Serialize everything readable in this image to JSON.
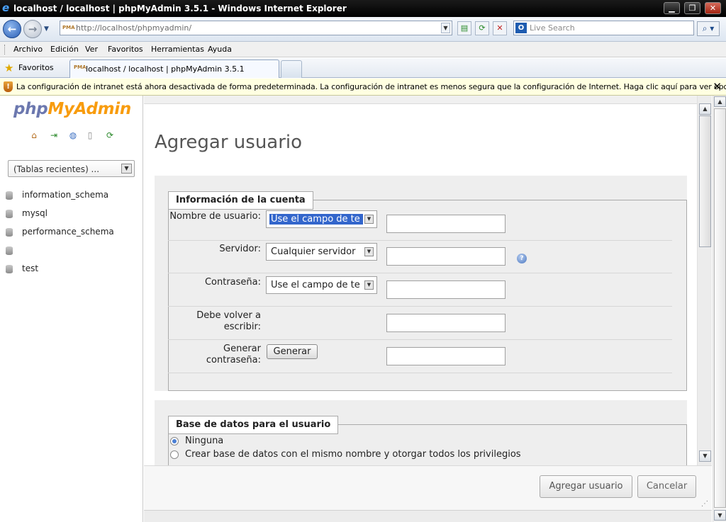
{
  "window": {
    "title": "localhost / localhost | phpMyAdmin 3.5.1 - Windows Internet Explorer",
    "minimize": "▁",
    "maximize": "❐",
    "close": "✕"
  },
  "address": {
    "url": "http://localhost/phpmyadmin/",
    "search_placeholder": "Live Search"
  },
  "menu": [
    "Archivo",
    "Edición",
    "Ver",
    "Favoritos",
    "Herramientas",
    "Ayuda"
  ],
  "favorites": {
    "label": "Favoritos",
    "tab_title": "localhost / localhost | phpMyAdmin 3.5.1"
  },
  "infobar": {
    "text": "La configuración de intranet está ahora desactivada de forma predeterminada. La configuración de intranet es menos segura que la configuración de Internet. Haga clic aquí para ver  opciones..."
  },
  "sidebar": {
    "logo_php": "php",
    "logo_myadmin": "MyAdmin",
    "recent_tables": "(Tablas recientes) ...",
    "databases": [
      "information_schema",
      "mysql",
      "performance_schema",
      "",
      "test"
    ]
  },
  "page": {
    "title": "Agregar usuario",
    "account_legend": "Información de la cuenta",
    "fields": {
      "username_label": "Nombre de usuario:",
      "username_select": "Use el campo de te",
      "server_label": "Servidor:",
      "server_select": "Cualquier servidor",
      "password_label": "Contraseña:",
      "password_select": "Use el campo de te",
      "retype_label_1": "Debe volver a",
      "retype_label_2": "escribir:",
      "generate_label_1": "Generar",
      "generate_label_2": "contraseña:",
      "generate_button": "Generar"
    },
    "db_legend": "Base de datos para el usuario",
    "db_options": [
      "Ninguna",
      "Crear base de datos con el mismo nombre y otorgar todos los privilegios"
    ]
  },
  "actions": {
    "add_user": "Agregar usuario",
    "cancel": "Cancelar"
  },
  "colors": {
    "logo_php": "#6c78af",
    "logo_myadmin": "#f89c0e",
    "selection": "#3366cc",
    "infobar": "#ffffe1"
  }
}
